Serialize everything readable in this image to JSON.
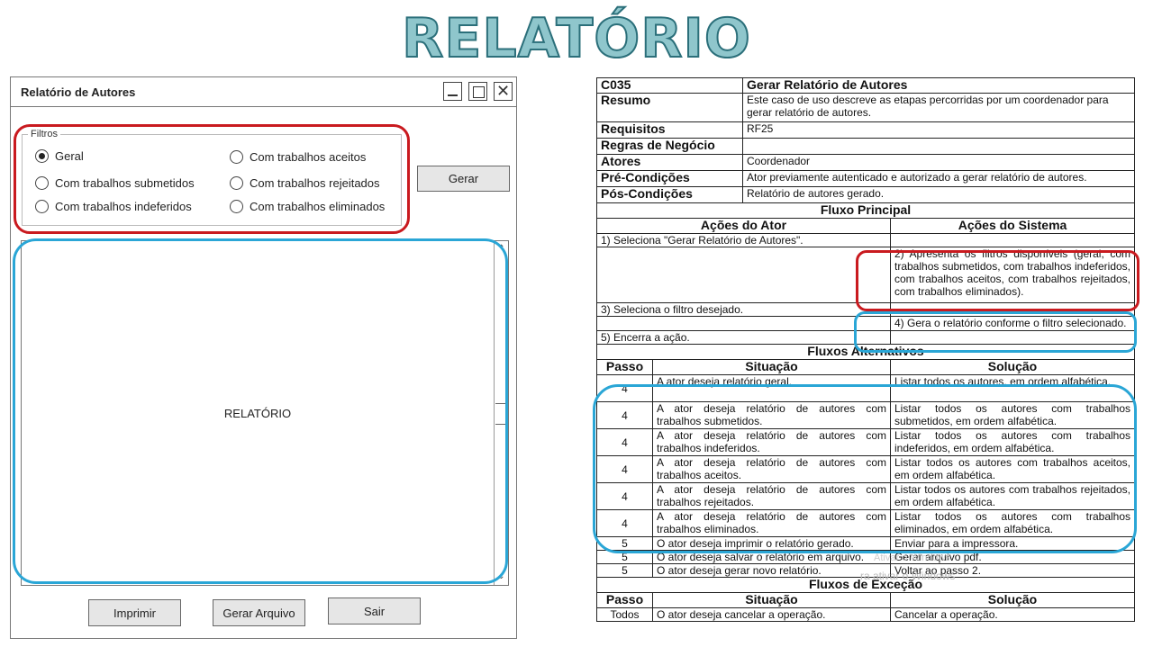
{
  "page_title": "RELATÓRIO",
  "window": {
    "title": "Relatório de Autores",
    "filters_legend": "Filtros",
    "radios": [
      {
        "label": "Geral",
        "checked": true
      },
      {
        "label": "Com trabalhos submetidos",
        "checked": false
      },
      {
        "label": "Com trabalhos indeferidos",
        "checked": false
      },
      {
        "label": "Com trabalhos aceitos",
        "checked": false
      },
      {
        "label": "Com trabalhos rejeitados",
        "checked": false
      },
      {
        "label": "Com trabalhos eliminados",
        "checked": false
      }
    ],
    "generate_label": "Gerar",
    "report_label": "RELATÓRIO",
    "print_label": "Imprimir",
    "file_label": "Gerar Arquivo",
    "exit_label": "Sair"
  },
  "usecase": {
    "code": "C035",
    "name": "Gerar Relatório de Autores",
    "rows": [
      {
        "key": "Resumo",
        "value": "Este caso de uso descreve as etapas percorridas por um coordenador para gerar relatório de autores."
      },
      {
        "key": "Requisitos",
        "value": "RF25"
      },
      {
        "key": "Regras de Negócio",
        "value": ""
      },
      {
        "key": "Atores",
        "value": "Coordenador"
      },
      {
        "key": "Pré-Condições",
        "value": "Ator previamente autenticado e autorizado a gerar relatório de autores."
      },
      {
        "key": "Pós-Condições",
        "value": "Relatório de autores gerado."
      }
    ],
    "main_flow_title": "Fluxo Principal",
    "actor_actions_title": "Ações do Ator",
    "system_actions_title": "Ações do Sistema",
    "step1": "1) Seleciona \"Gerar Relatório de Autores\".",
    "step2": "2) Apresenta os filtros disponíveis (geral, com trabalhos submetidos, com trabalhos indeferidos, com trabalhos aceitos, com trabalhos rejeitados, com trabalhos eliminados).",
    "step3": "3) Seleciona o filtro desejado.",
    "step4": "4) Gera o relatório conforme o filtro selecionado.",
    "step5": "5) Encerra a ação.",
    "alt_title": "Fluxos Alternativos",
    "col_step": "Passo",
    "col_situation": "Situação",
    "col_solution": "Solução",
    "alt_rows": [
      {
        "step": "4",
        "situation": "A ator deseja relatório geral.",
        "solution": "Listar todos os autores, em ordem alfabética."
      },
      {
        "step": "4",
        "situation": "A ator deseja relatório de autores com trabalhos submetidos.",
        "solution": "Listar todos os autores com trabalhos submetidos, em ordem alfabética."
      },
      {
        "step": "4",
        "situation": "A ator deseja relatório de autores com trabalhos indeferidos.",
        "solution": "Listar todos os autores com trabalhos indeferidos, em ordem alfabética."
      },
      {
        "step": "4",
        "situation": "A ator deseja relatório de autores com trabalhos aceitos.",
        "solution": "Listar todos os autores com trabalhos aceitos, em ordem alfabética."
      },
      {
        "step": "4",
        "situation": "A ator deseja relatório de autores com trabalhos rejeitados.",
        "solution": "Listar todos os autores com trabalhos rejeitados, em ordem alfabética."
      },
      {
        "step": "4",
        "situation": "A ator deseja relatório de autores com trabalhos eliminados.",
        "solution": "Listar todos os autores com trabalhos eliminados, em ordem alfabética."
      },
      {
        "step": "5",
        "situation": "O ator deseja imprimir o relatório gerado.",
        "solution": "Enviar para a impressora."
      },
      {
        "step": "5",
        "situation": "O ator deseja salvar o relatório em arquivo.",
        "solution": "Gerar arquivo pdf."
      },
      {
        "step": "5",
        "situation": "O ator deseja gerar novo relatório.",
        "solution": "Voltar ao passo 2."
      }
    ],
    "exc_title": "Fluxos de Exceção",
    "exc_row": {
      "step": "Todos",
      "situation": "O ator deseja cancelar a operação.",
      "solution": "Cancelar a operação."
    }
  },
  "watermark": "ra ativar o Windows",
  "watermark_top": "Ativar o Windows",
  "colors": {
    "highlight_red": "#c91a1f",
    "highlight_blue": "#2aa6d6",
    "title_fill": "#8fc6cc"
  }
}
